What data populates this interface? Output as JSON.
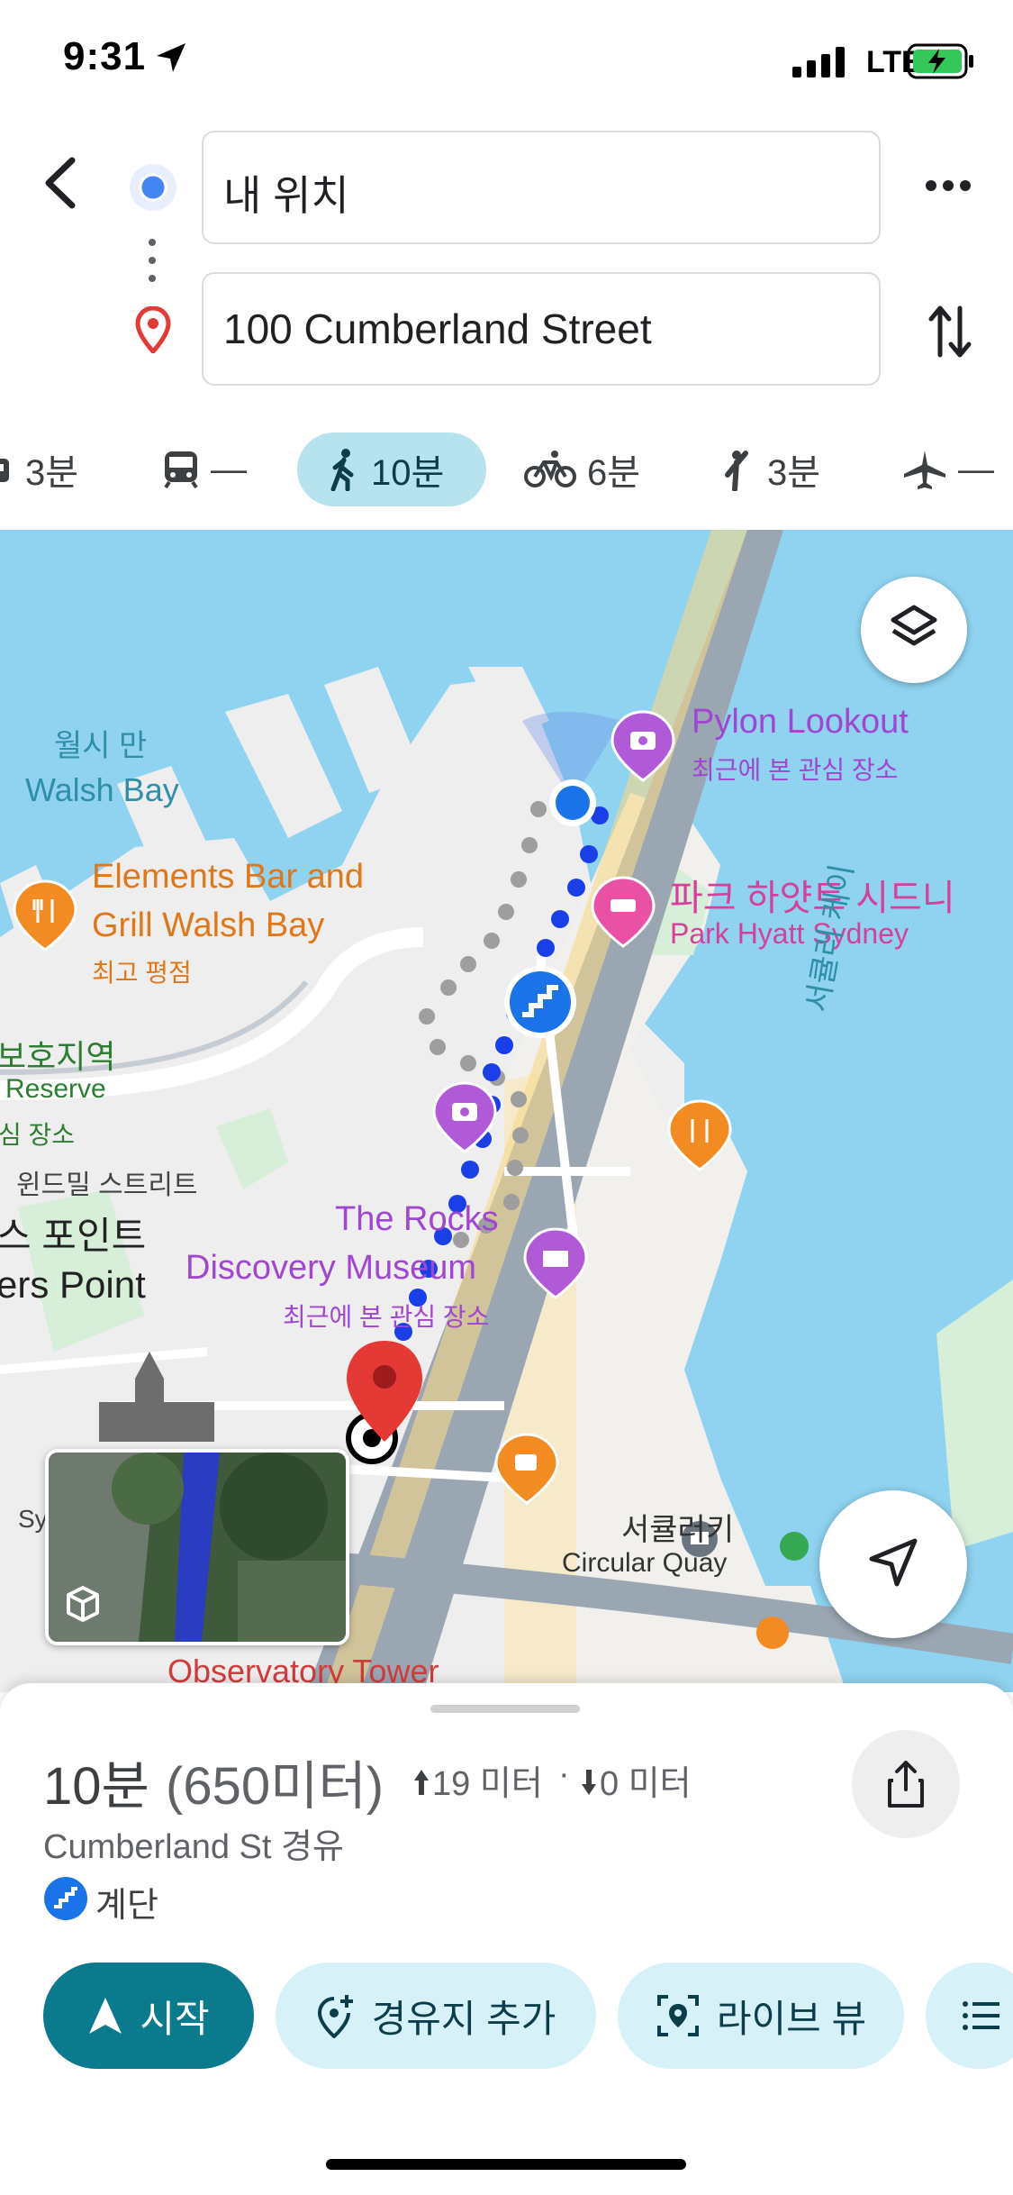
{
  "status_bar": {
    "time": "9:31",
    "network": "LTE"
  },
  "directions": {
    "origin": "내 위치",
    "destination": "100 Cumberland Street"
  },
  "modes": [
    {
      "icon": "car-icon",
      "label": "3분"
    },
    {
      "icon": "train-icon",
      "label": "—"
    },
    {
      "icon": "walk-icon",
      "label": "10분",
      "selected": true
    },
    {
      "icon": "bike-icon",
      "label": "6분"
    },
    {
      "icon": "hail-icon",
      "label": "3분"
    },
    {
      "icon": "plane-icon",
      "label": "—"
    }
  ],
  "map": {
    "labels": {
      "walsh_bay_ko": "월시 만",
      "walsh_bay_en": "Walsh Bay",
      "pylon_title": "Pylon Lookout",
      "pylon_sub": "최근에 본 관심 장소",
      "park_hyatt_ko": "파크 하얏트 시드니",
      "park_hyatt_en": "Park Hyatt Sydney",
      "elements_1": "Elements Bar and",
      "elements_2": "Grill Walsh Bay",
      "elements_sub": "최고 평점",
      "reserve_ko": "보호지역",
      "reserve_en": "Reserve",
      "reserve_sub": "심 장소",
      "windmill": "윈드밀 스트리트",
      "point_ko": "스 포인트",
      "point_en": "ers Point",
      "rocks_1": "The Rocks",
      "rocks_2": "Discovery Museum",
      "rocks_sub": "최근에 본 관심 장소",
      "circular_ko": "서큘러키",
      "circular_en": "Circular Quay",
      "quay_vertical": "서큘러 케이",
      "observatory": "Observatory Tower",
      "sy": "Sy"
    }
  },
  "route": {
    "time": "10분",
    "distance": "(650미터)",
    "ascent": "19 미터",
    "separator": "·",
    "descent": "0 미터",
    "via": "Cumberland St 경유",
    "warning": "계단"
  },
  "actions": {
    "start": "시작",
    "add_stop": "경유지 추가",
    "live_view": "라이브 뷰"
  },
  "colors": {
    "accent": "#0b7a8c",
    "route_blue": "#1a3ee8",
    "water": "#8fd3f0",
    "poi_purple": "#b15ad8",
    "poi_orange": "#f28b22",
    "poi_pink": "#e951a5",
    "pin_red": "#e53935"
  }
}
